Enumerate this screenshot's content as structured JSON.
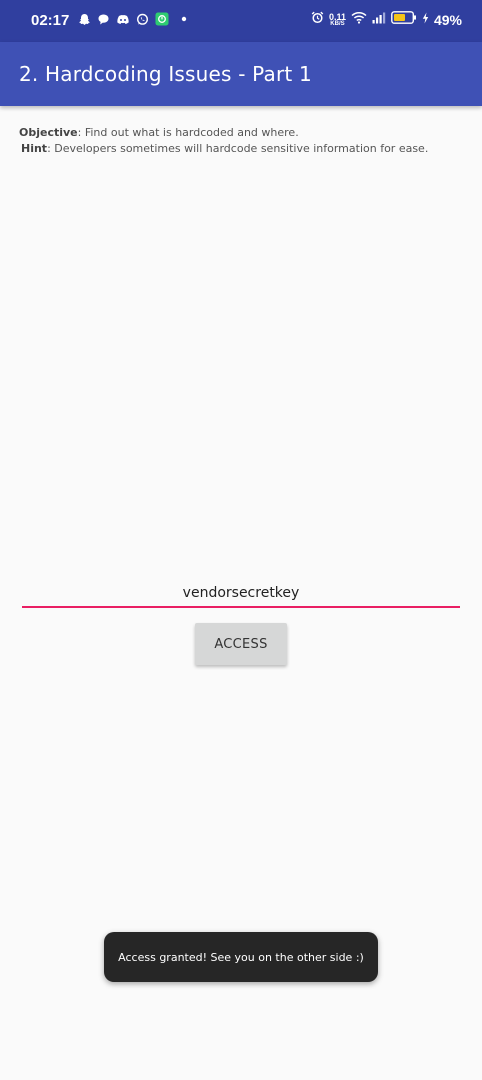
{
  "status_bar": {
    "time": "02:17",
    "net_speed_value": "0.11",
    "net_speed_unit": "KB/S",
    "battery_percent": "49%",
    "left_icons": [
      "snapchat-icon",
      "chat-bubble-icon",
      "discord-icon",
      "whatsapp-icon",
      "app-badge-icon",
      "dot-icon"
    ],
    "right_icons": [
      "alarm-icon",
      "wifi-icon",
      "signal-icon",
      "battery-icon",
      "charging-bolt-icon"
    ],
    "colors": {
      "status_bar_bg": "#303f9f",
      "battery_fill": "#f5c518"
    }
  },
  "app_bar": {
    "title": "2. Hardcoding Issues - Part 1",
    "color": "#3f51b5"
  },
  "content": {
    "objective_label": "Objective",
    "objective_text": ": Find out what is hardcoded and where.",
    "hint_label": "Hint",
    "hint_text": ": Developers sometimes will hardcode sensitive information for ease.",
    "input_value": "vendorsecretkey",
    "input_underline_color": "#e91e63",
    "access_button_label": "ACCESS"
  },
  "toast": {
    "message": "Access granted! See you on the other side :)"
  }
}
